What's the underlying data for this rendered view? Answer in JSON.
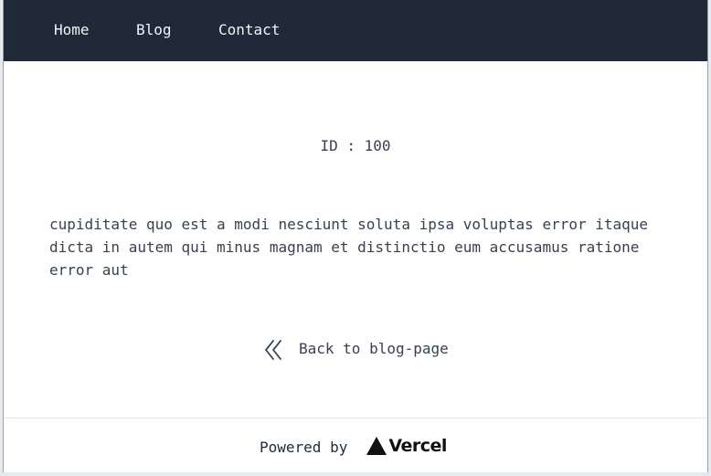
{
  "nav": {
    "home": "Home",
    "blog": "Blog",
    "contact": "Contact"
  },
  "post": {
    "id_text": "ID : 100",
    "body": "cupiditate quo est a modi nesciunt soluta ipsa voluptas error itaque dicta in autem qui minus magnam et distinctio eum accusamus ratione error aut"
  },
  "back": {
    "label": "Back to blog-page",
    "icon": "double-chevron-left-icon"
  },
  "footer": {
    "powered_by": "Powered by",
    "brand": "Vercel",
    "brand_icon": "vercel-triangle-icon"
  },
  "colors": {
    "navbar_bg": "#1f2937",
    "nav_text": "#f3f4f6",
    "body_text": "#374151",
    "page_bg": "#ffffff"
  }
}
